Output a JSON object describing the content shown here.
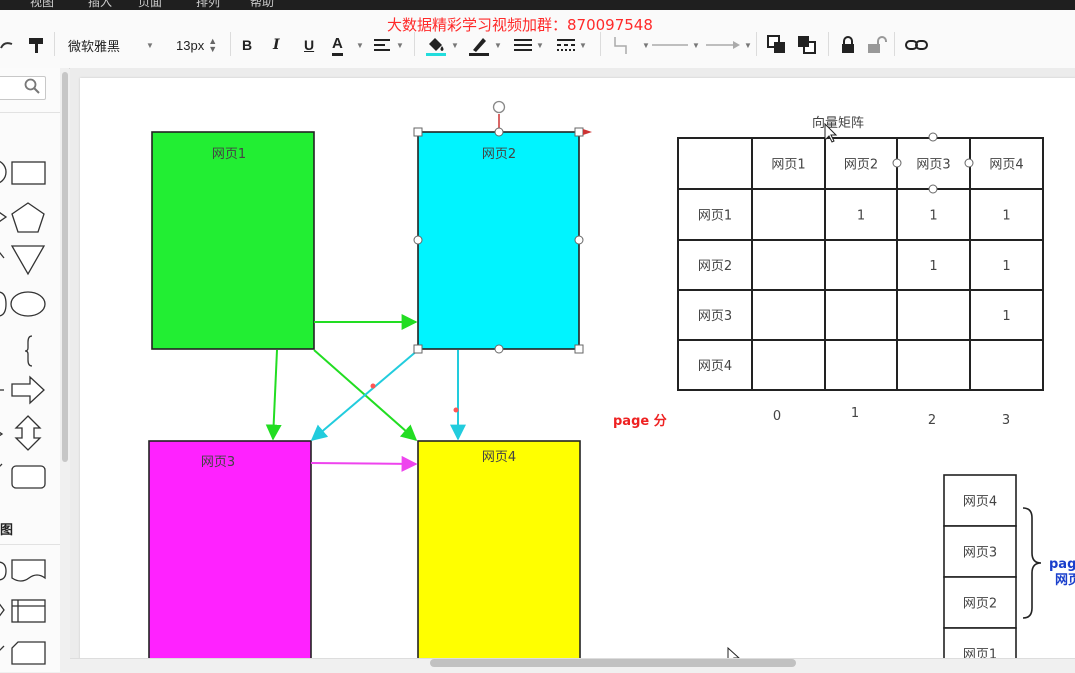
{
  "menubar": {
    "items": [
      "视图",
      "插入",
      "页面",
      "排列",
      "帮助"
    ]
  },
  "watermark": "大数据精彩学习视频加群：870097548",
  "toolbar": {
    "font_family": "微软雅黑",
    "font_size": "13px",
    "bold": "B",
    "italic": "I",
    "underline": "U",
    "font_color": "A"
  },
  "sidebar": {
    "section_label": "图"
  },
  "diagram": {
    "pages": [
      {
        "label": "网页1",
        "color": "#22ee33"
      },
      {
        "label": "网页2",
        "color": "#00f4ff"
      },
      {
        "label": "网页3",
        "color": "#ff22ff"
      },
      {
        "label": "网页4",
        "color": "#ffff00"
      }
    ],
    "arrow_colors": {
      "green": "#22dd22",
      "cyan": "#22ccdd",
      "magenta": "#ee44ee"
    },
    "matrix_title": "向量矩阵",
    "matrix": {
      "col_headers": [
        "",
        "网页1",
        "网页2",
        "网页3",
        "网页4"
      ],
      "rows": [
        [
          "网页1",
          "",
          "1",
          "1",
          "1"
        ],
        [
          "网页2",
          "",
          "",
          "1",
          "1"
        ],
        [
          "网页3",
          "",
          "",
          "",
          "1"
        ],
        [
          "网页4",
          "",
          "",
          "",
          ""
        ]
      ]
    },
    "index_labels": [
      "0",
      "1",
      "2",
      "3"
    ],
    "page_rank_label": "page  分",
    "stack": [
      "网页4",
      "网页3",
      "网页2",
      "网页1"
    ],
    "stack_label_line1": "pag",
    "stack_label_line2": "网页"
  }
}
